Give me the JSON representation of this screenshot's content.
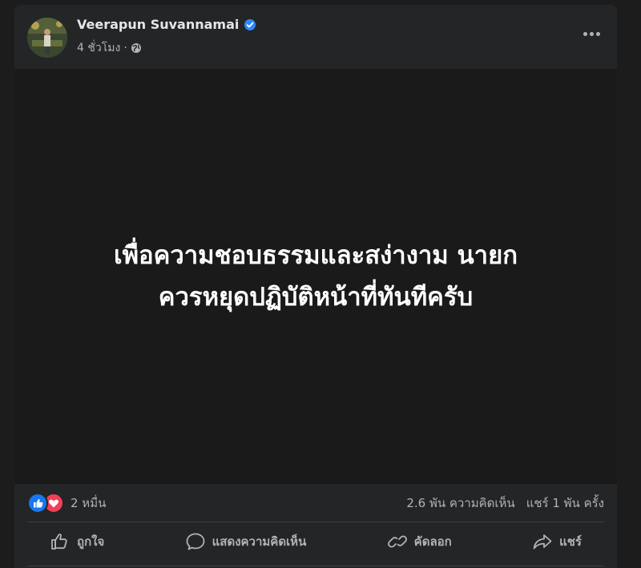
{
  "post": {
    "author": "Veerapun Suvannamai",
    "verified": true,
    "time": "4 ชั่วโมง",
    "separator": "·",
    "privacy_icon": "globe-icon",
    "menu_icon": "more-horizontal-icon",
    "content_lines": [
      "เพื่อความชอบธรรมและสง่างาม นายก",
      "ควรหยุดปฏิบัติหน้าที่ทันทีครับ"
    ],
    "content_bg": "#1a1a1a",
    "content_color": "#ffffff"
  },
  "stats": {
    "reaction_icons": [
      "like-icon",
      "love-icon"
    ],
    "reaction_count": "2 หมื่น",
    "comments": "2.6 พัน ความคิดเห็น",
    "shares": "แชร์ 1 พัน ครั้ง"
  },
  "actions": [
    {
      "label": "ถูกใจ",
      "icon": "thumbs-up-icon"
    },
    {
      "label": "แสดงความคิดเห็น",
      "icon": "comment-icon"
    },
    {
      "label": "คัดลอก",
      "icon": "link-icon"
    },
    {
      "label": "แชร์",
      "icon": "share-icon"
    }
  ],
  "colors": {
    "page_bg": "#1c1c1d",
    "card_bg": "#242526",
    "text_primary": "#e4e6eb",
    "text_secondary": "#b0b3b8",
    "accent": "#1877f2",
    "love": "#f33e58"
  }
}
